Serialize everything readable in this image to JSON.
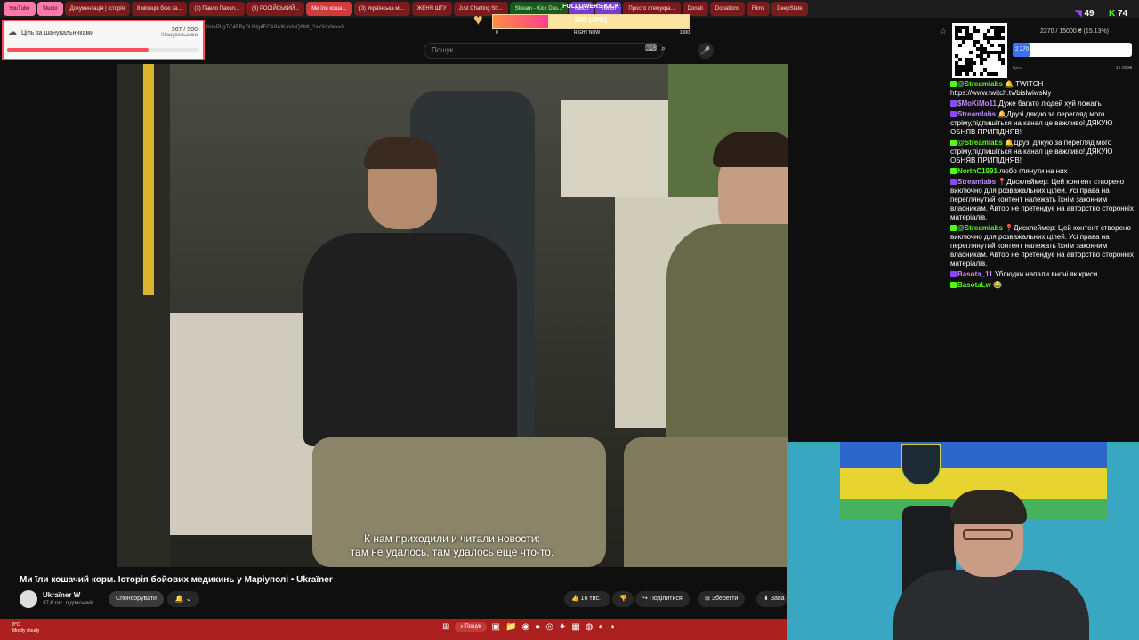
{
  "browser": {
    "tabs": [
      "YouTube",
      "Studio",
      "Документація | Історія",
      "8 місяців бою за...",
      "(3) Павло Пахол...",
      "(3) РОСІЙСЬКИЙ...",
      "Ми їли коша...",
      "(3) Українська мі...",
      "ЖЕНЯ ШТУ",
      "Just Chatting Str...",
      "Stream - Kick Das...",
      "twitch",
      "Twitch",
      "Просто стемукра...",
      "Donati",
      "Donations",
      "Films",
      "DeepState"
    ],
    "address": "list=PLgTC4FByDU3lg4ECA8AIK-ndaQ8Mt_2aY&index=9"
  },
  "follower_goal": {
    "title": "Ціль за шанувальниками",
    "count": "367 / 500",
    "sub": "Шанувальники",
    "progress": 0.734
  },
  "kick_goal": {
    "title": "FOLLOWERS KICK",
    "value": "289 (28%)",
    "progress": 0.28,
    "min": "0",
    "mid": "RIGHT NOW",
    "max": "1000"
  },
  "youtube": {
    "search_placeholder": "Пошук",
    "subtitle_line1": "К нам приходили и читали новости:",
    "subtitle_line2": "там не удалось, там удалось еще что-то.",
    "video_title": "Ми їли кошачий корм. Історія бойових медикинь у Маріуполі • Ukraїner",
    "channel_name": "Ukraїner W",
    "channel_subs": "37,6 тис. підписників",
    "sponsor_label": "Спонсорувати",
    "likes": "16 тис.",
    "share_label": "Поділитися",
    "save_label": "Зберегти",
    "download_label": "Зава"
  },
  "donation": {
    "text": "2270 / 15000 ₴ (15.13%)",
    "bar_label": "2 270",
    "goal_label": "Ціль",
    "max": "15 000₴",
    "progress": 0.1513
  },
  "viewers": {
    "twitch": "49",
    "kick": "74"
  },
  "chat": [
    {
      "user": "@Streamlabs",
      "platform": "kick",
      "text": "🔔 TWITCH - https://www.twitch.tv/bislwiwskiy"
    },
    {
      "user": "$MoKiMo11",
      "platform": "twitch",
      "text": "Дуже багато людей хуй ложать"
    },
    {
      "user": "Streamlabs",
      "platform": "twitch",
      "text": "🔔Друзі дякую за перегляд мого стріму,підпишіться на канал це важливо! ДЯКУЮ ОБНЯВ ПРИПІДНЯВ!"
    },
    {
      "user": "@Streamlabs",
      "platform": "kick",
      "text": "🔔Друзі дякую за перегляд мого стріму,підпишіться на канал це важливо! ДЯКУЮ ОБНЯВ ПРИПІДНЯВ!"
    },
    {
      "user": "NorthC1991",
      "platform": "kick",
      "text": "любо глянути на них"
    },
    {
      "user": "Streamlabs",
      "platform": "twitch",
      "text": "📍Дисклеймер: Цей контент створено виключно для розважальних цілей. Усі права на переглянутий контент належать їхнім законним власникам. Автор не претендує на авторство сторонніх матеріалів."
    },
    {
      "user": "@Streamlabs",
      "platform": "kick",
      "text": "📍Дисклеймер: Цей контент створено виключно для розважальних цілей. Усі права на переглянутий контент належать їхнім законним власникам. Автор не претендує на авторство сторонніх матеріалів."
    },
    {
      "user": "Basota_11",
      "platform": "twitch",
      "text": "Ублюдки напали вночі як криси"
    },
    {
      "user": "BasotaLw",
      "platform": "kick",
      "text": "😂"
    }
  ],
  "taskbar": {
    "temp": "8°C",
    "weather": "Mostly cloudy",
    "search": "Пошук"
  },
  "colors": {
    "accent_red": "#ab1f1f",
    "kick_green": "#53fc18",
    "twitch_purple": "#9146ff"
  }
}
